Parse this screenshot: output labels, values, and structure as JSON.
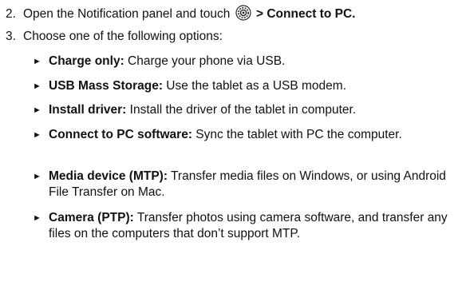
{
  "steps": [
    {
      "number": "2.",
      "before_icon": "Open the Notification panel and touch",
      "icon": "settings-gear-icon",
      "after_icon": " > Connect to PC",
      "trailing": "."
    },
    {
      "number": "3.",
      "text": "Choose one of the following options:"
    }
  ],
  "options": [
    {
      "title": "Charge only:",
      "desc": " Charge your phone via USB."
    },
    {
      "title": "USB Mass Storage:",
      "desc": " Use the tablet as a USB modem."
    },
    {
      "title": "Install driver:",
      "desc": " Install the driver of the tablet in computer."
    },
    {
      "title": "Connect to PC software:",
      "desc": " Sync the tablet with PC the computer."
    },
    {
      "title": "Media device (MTP):",
      "desc": " Transfer media files on Windows, or using Android File Transfer on Mac."
    },
    {
      "title": "Camera (PTP):",
      "desc": " Transfer photos using camera software, and transfer any files on the computers that don’t support MTP."
    }
  ],
  "bullet_glyph": "►"
}
